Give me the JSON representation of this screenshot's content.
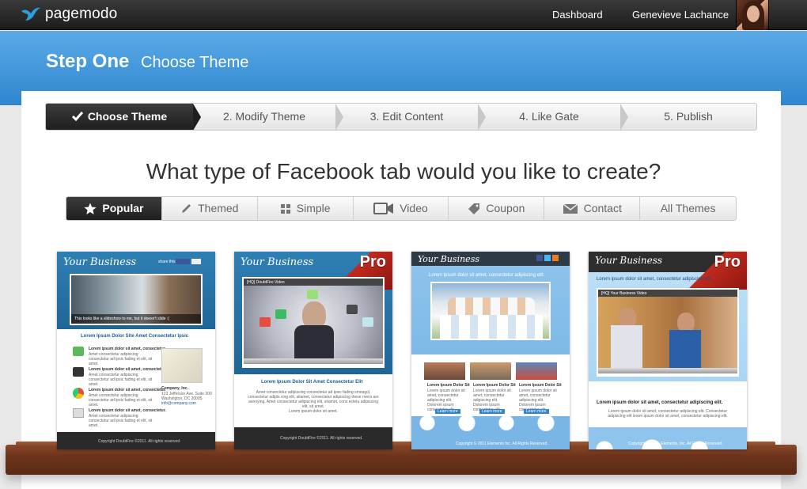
{
  "topbar": {
    "logo_text": "pagemodo",
    "nav": [
      "Dashboard",
      "Genevieve Lachance"
    ]
  },
  "header": {
    "title": "Step One",
    "subtitle": "Choose Theme"
  },
  "wizard": {
    "steps": [
      "Choose Theme",
      "2. Modify Theme",
      "3. Edit Content",
      "4. Like Gate",
      "5. Publish"
    ],
    "active_index": 0
  },
  "question": "What type of Facebook tab would you like to create?",
  "categories": {
    "items": [
      {
        "label": "Popular",
        "icon": "star-icon"
      },
      {
        "label": "Themed",
        "icon": "pencil-icon"
      },
      {
        "label": "Simple",
        "icon": "grid-icon"
      },
      {
        "label": "Video",
        "icon": "video-camera-icon"
      },
      {
        "label": "Coupon",
        "icon": "tag-icon"
      },
      {
        "label": "Contact",
        "icon": "envelope-icon"
      },
      {
        "label": "All Themes",
        "icon": ""
      }
    ],
    "active_index": 0
  },
  "templates": [
    {
      "business": "Your Business",
      "share": "share this!",
      "slide_caption": "This looks like a slideshow to me, but it doesn't slide :(",
      "heading": "Lorem Ipsum Dolor Site Amet Consectetur Ipsic",
      "item_title": "Lorem ipsum dolor sit amet, consectetur.",
      "item_text": "Amet consectetur adipiscing consectetur ad ipsic fading et elit, sit amet.",
      "company": "Company, Inc.",
      "address": [
        "123 Jefferson Ave. Suite 300",
        "Washington, DC 20005",
        "info@company.com"
      ],
      "footer": "Copyright DoubtFire ©2011. All rights reserved.",
      "pro": false
    },
    {
      "business": "Your Business",
      "video_title": "[HQ] DoubtFire Video",
      "heading": "Lorem Ipsum Dolor Sit Amet Consectetur Elit",
      "body": "Amet consectetur adipiscing consectetur ad ipsic fading smeagol, consectetur adipis cing elit, sitamet, consectetur adipiscing these rivers are annoying. Amet consectetur adipiscing elit, sitamet, cons ectetu adipiscing elit, sit amet.",
      "body_end": "Lorem ipsum dolor sit amet.",
      "footer": "Copyright DoubtFire ©2011. All rights reserved.",
      "pro": true,
      "pro_label": "Pro"
    },
    {
      "business": "Your Business",
      "tagline": "Lorem ipsum dolor sit amet, consectetur adipiscing elit.",
      "col_title": "Lorem Ipsum Dolor Sit",
      "col_text": "Lorem ipsum dolor sit amet, consectetur adipiscing elit. Dolorem ipsum consectetur elit.",
      "button": "Learn more",
      "footer": "Copyright © 2011 Elements Inc. All Rights Reserved.",
      "pro": false
    },
    {
      "business": "Your Business",
      "tagline": "Lorem ipsum dolor sit amet, consectetur adipiscing elit.",
      "video_title": "[HQ] Your Business Video",
      "heading": "Lorem ipsum dolor sit amet, consectetur adipiscing elit.",
      "body": "Lorem ipsum dolor sit amet, consectetur adipiscing elit. Consectetur adipiscing elit lorem ipsum dolor sit amet, consectetur adipiscing elit.",
      "footer": "Copyright © 2011, Elements, Inc. All Rights Reserved.",
      "pro": true,
      "pro_label": "Pro"
    }
  ],
  "colors": {
    "header_blue": "#3d92d8",
    "dark_tab": "#2a2a2a",
    "shelf_wood": "#6f351c",
    "template1_blue": "#1f6fa0",
    "template3_sky": "#8fc4ec",
    "pro_red": "#c12a1f"
  }
}
